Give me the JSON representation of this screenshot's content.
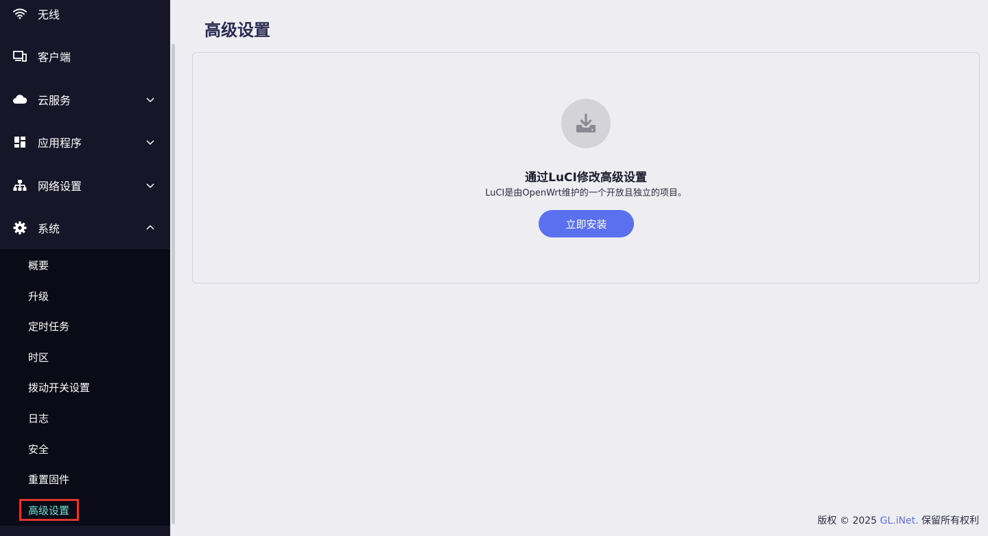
{
  "sidebar": {
    "items": [
      {
        "label": "无线",
        "icon": "wifi-icon"
      },
      {
        "label": "客户端",
        "icon": "devices-icon"
      },
      {
        "label": "云服务",
        "icon": "cloud-icon"
      },
      {
        "label": "应用程序",
        "icon": "apps-grid-icon"
      },
      {
        "label": "网络设置",
        "icon": "network-icon"
      },
      {
        "label": "系统",
        "icon": "gear-icon"
      }
    ],
    "system_submenu": [
      "概要",
      "升级",
      "定时任务",
      "时区",
      "拨动开关设置",
      "日志",
      "安全",
      "重置固件",
      "高级设置"
    ],
    "active_sub": "高级设置"
  },
  "main": {
    "title": "高级设置",
    "card": {
      "icon": "download-icon",
      "title": "通过LuCI修改高级设置",
      "description": "LuCI是由OpenWrt维护的一个开放且独立的项目。",
      "button": "立即安装"
    }
  },
  "footer": {
    "prefix": "版权 © 2025",
    "link": "GL.iNet.",
    "suffix": "保留所有权利"
  },
  "colors": {
    "sidebar_bg": "#171628",
    "submenu_bg": "#0b0a17",
    "accent": "#5b70ef",
    "active_text": "#6fe3d6",
    "highlight": "#e0352b"
  }
}
